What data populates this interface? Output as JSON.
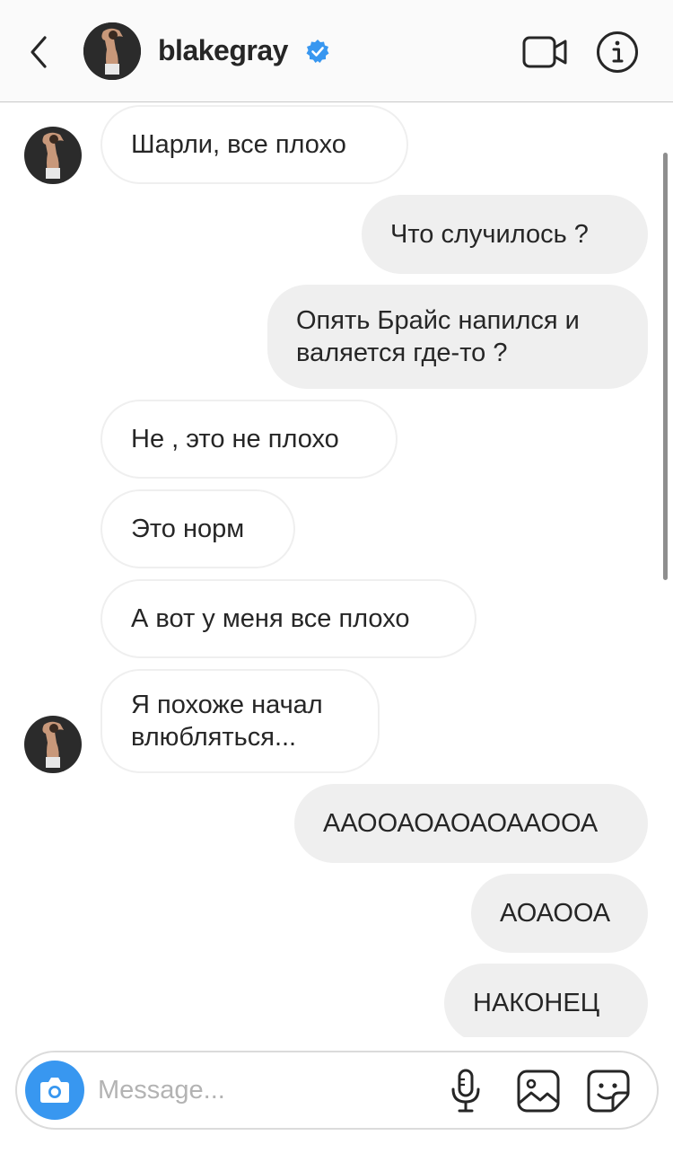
{
  "header": {
    "username": "blakegray",
    "back_icon": "chevron-left-icon",
    "verified_icon": "verified-badge-icon",
    "video_icon": "video-camera-icon",
    "info_icon": "info-icon",
    "accent_color": "#3897f0"
  },
  "messages": [
    {
      "direction": "incoming",
      "text": "Шарли, все плохо",
      "show_avatar": true
    },
    {
      "direction": "outgoing",
      "text": "Что случилось ?"
    },
    {
      "direction": "outgoing",
      "lines": [
        "Опять Брайс напился и",
        "валяется где-то ?"
      ]
    },
    {
      "direction": "incoming",
      "text": "Не , это не плохо"
    },
    {
      "direction": "incoming",
      "text": "Это норм"
    },
    {
      "direction": "incoming",
      "text": "А вот у меня все плохо"
    },
    {
      "direction": "incoming",
      "lines": [
        "Я похоже начал",
        "влюбляться..."
      ],
      "show_avatar": true
    },
    {
      "direction": "outgoing",
      "text": "ААООАОАОАОААООА"
    },
    {
      "direction": "outgoing",
      "text": "АОАООА"
    },
    {
      "direction": "outgoing",
      "text": "НАКОНЕЦ"
    }
  ],
  "composer": {
    "placeholder": "Message...",
    "camera_icon": "camera-icon",
    "mic_icon": "microphone-icon",
    "gallery_icon": "image-icon",
    "sticker_icon": "sticker-icon"
  }
}
